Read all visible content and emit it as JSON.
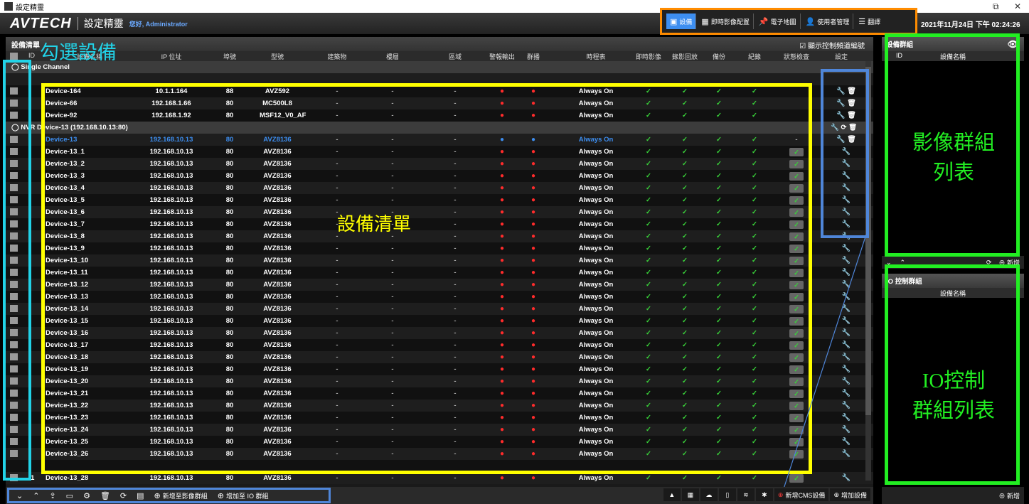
{
  "window": {
    "title": "設定精靈",
    "maximize": "⧉",
    "close": "✕"
  },
  "header": {
    "logo": "AVTECH",
    "app_name": "設定精靈",
    "greeting": "您好,",
    "user": "Administrator",
    "clock": "2021年11月24日 下午 02:24:26"
  },
  "nav": {
    "devices": "設備",
    "live_layout": "即時影像配置",
    "emap": "電子地圖",
    "user_mgmt": "使用者管理",
    "translate": "翻譯"
  },
  "list": {
    "title": "設備清單",
    "show_channel_numbers": "顯示控制頻道編號",
    "columns": {
      "id": "ID",
      "name": "設備名稱",
      "ip": "IP 位址",
      "port": "埠號",
      "model": "型號",
      "building": "建築物",
      "floor": "樓層",
      "area": "區域",
      "alarm_out": "警報輸出",
      "broadcast": "群播",
      "schedule": "時程表",
      "live": "即時影像",
      "playback": "錄影回放",
      "backup": "備份",
      "log": "紀錄",
      "status": "狀態檢查",
      "settings": "設定"
    },
    "group_single": "Single Channel",
    "group_nvr": "NVR",
    "group_nvr_detail": "Device-13 (192.168.10.13:80)",
    "single_rows": [
      {
        "name": "Device-164",
        "ip": "10.1.1.164",
        "port": "88",
        "model": "AVZ592"
      },
      {
        "name": "Device-66",
        "ip": "192.168.1.66",
        "port": "80",
        "model": "MC500L8"
      },
      {
        "name": "Device-92",
        "ip": "192.168.1.92",
        "port": "80",
        "model": "MSF12_V0_AF"
      }
    ],
    "nvr_parent": {
      "name": "Device-13",
      "ip": "192.168.10.13",
      "port": "80",
      "model": "AVZ8136"
    },
    "nvr_rows": [
      "Device-13_1",
      "Device-13_2",
      "Device-13_3",
      "Device-13_4",
      "Device-13_5",
      "Device-13_6",
      "Device-13_7",
      "Device-13_8",
      "Device-13_9",
      "Device-13_10",
      "Device-13_11",
      "Device-13_12",
      "Device-13_13",
      "Device-13_14",
      "Device-13_15",
      "Device-13_16",
      "Device-13_17",
      "Device-13_18",
      "Device-13_19",
      "Device-13_20",
      "Device-13_21",
      "Device-13_22",
      "Device-13_23",
      "Device-13_24",
      "Device-13_25",
      "Device-13_26"
    ],
    "nvr_ip": "192.168.10.13",
    "nvr_port": "80",
    "nvr_model": "AVZ8136",
    "last_row": {
      "id": "-1",
      "name": "Device-13_28",
      "ip": "192.168.10.13",
      "port": "80",
      "model": "AVZ8136"
    },
    "dash": "-",
    "schedule_value": "Always On",
    "check": "✓"
  },
  "annotations": {
    "select_devices": "勾選設備",
    "device_list": "設備清單",
    "video_groups": "影像群組\n列表",
    "io_groups": "IO控制\n群組列表"
  },
  "bottom": {
    "add_video_group": "新增至影像群組",
    "add_io_group": "增加至 IO 群組",
    "add_cms": "新增CMS設備",
    "add_device": "增加設備"
  },
  "right": {
    "device_group_title": "設備群組",
    "id": "ID",
    "name_col": "設備名稱",
    "add": "新增",
    "io_group_title": "IO 控制群組",
    "io_name_col": "設備名稱",
    "io_add": "新增"
  },
  "colors": {
    "accent": "#3d8ef0",
    "orange": "#ff8c00",
    "yellow": "#ffff00",
    "green": "#22ee22",
    "blue": "#4f86d9",
    "cyan": "#22d3e8"
  }
}
